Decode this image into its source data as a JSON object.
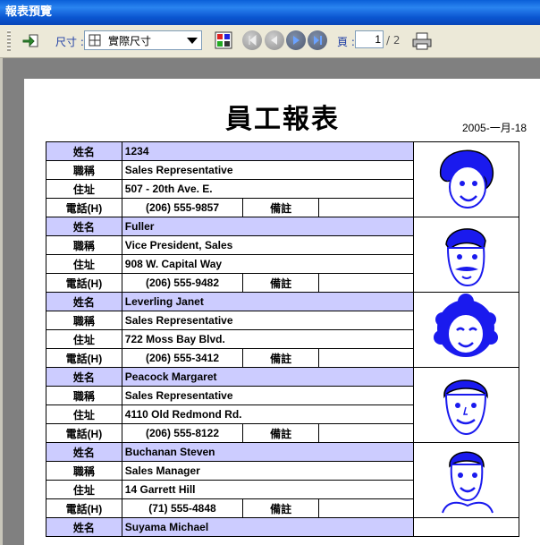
{
  "window": {
    "title": "報表預覽"
  },
  "toolbar": {
    "size_label": "尺寸 :",
    "size_value": "實際尺寸",
    "page_label": "頁 :",
    "page_current": "1",
    "page_total": "/ 2"
  },
  "report": {
    "title": "員工報表",
    "date": "2005-一月-18",
    "labels": {
      "name": "姓名",
      "title": "職稱",
      "address": "住址",
      "phone": "電話(H)",
      "note": "備註"
    },
    "employees": [
      {
        "name": "1234",
        "title": "Sales Representative",
        "address": "507 - 20th Ave. E.",
        "phone": "(206) 555-9857",
        "photo": "woman-curly-face-icon"
      },
      {
        "name": "Fuller",
        "title": "Vice President, Sales",
        "address": "908 W. Capital Way",
        "phone": "(206) 555-9482",
        "photo": "man-mustache-face-icon"
      },
      {
        "name": "Leverling Janet",
        "title": "Sales Representative",
        "address": "722 Moss Bay Blvd.",
        "phone": "(206) 555-3412",
        "photo": "woman-curly-hair-face-icon"
      },
      {
        "name": "Peacock Margaret",
        "title": "Sales Representative",
        "address": "4110 Old Redmond Rd.",
        "phone": "(206) 555-8122",
        "photo": "man-face-icon"
      },
      {
        "name": "Buchanan Steven",
        "title": "Sales Manager",
        "address": "14 Garrett Hill",
        "phone": "(71) 555-4848",
        "photo": "man-smiling-face-icon"
      }
    ],
    "partial_next_name": "Suyama Michael"
  }
}
